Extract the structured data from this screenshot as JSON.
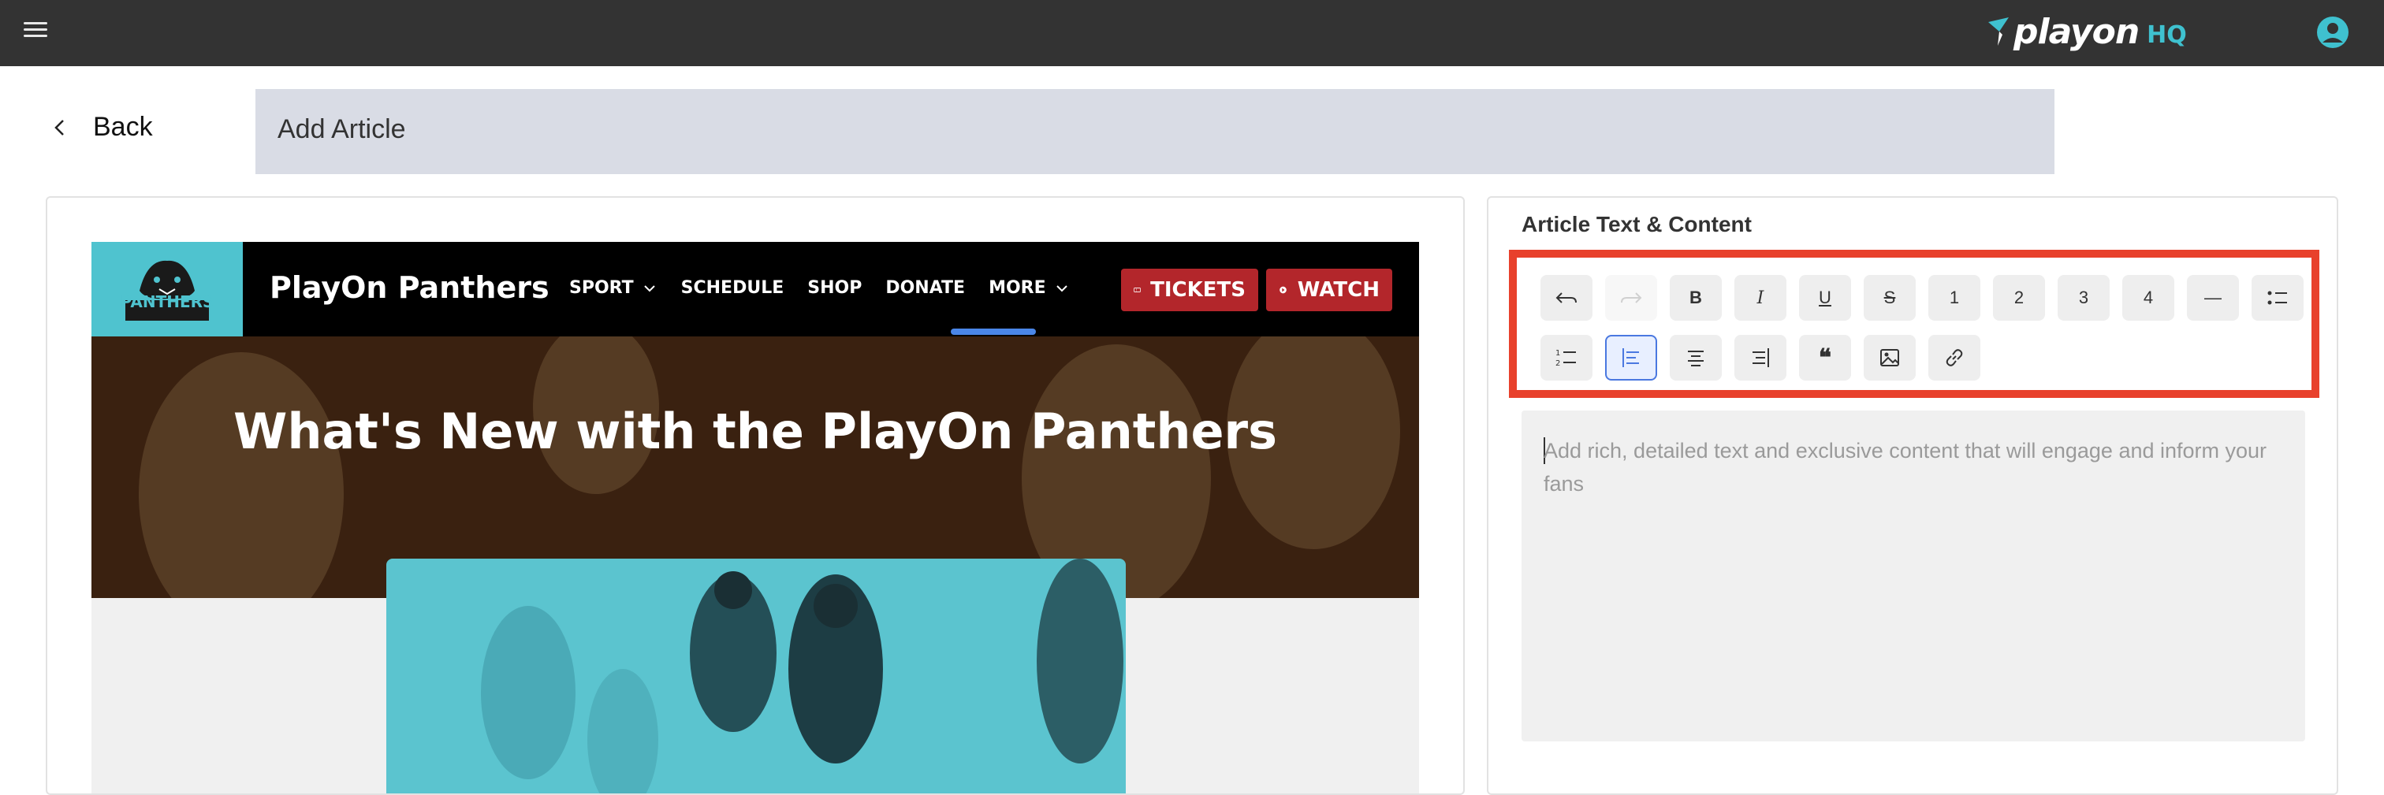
{
  "topbar": {
    "brand_word": "playon",
    "brand_suffix": "HQ",
    "brand_color": "#3fc1cf",
    "bg_color": "#333333"
  },
  "page": {
    "back_label": "Back",
    "title": "Add Article"
  },
  "preview": {
    "site_name": "PlayOn Panthers",
    "logo_text": "PANTHERS",
    "menu": [
      {
        "label": "SPORT",
        "has_dropdown": true
      },
      {
        "label": "SCHEDULE",
        "has_dropdown": false
      },
      {
        "label": "SHOP",
        "has_dropdown": false
      },
      {
        "label": "DONATE",
        "has_dropdown": false
      },
      {
        "label": "MORE",
        "has_dropdown": true
      }
    ],
    "tickets_label": "TICKETS",
    "watch_label": "WATCH",
    "hero_title": "What's New with the PlayOn Panthers",
    "accent_color": "#b3262b",
    "teal_color": "#4fc3cf"
  },
  "editor": {
    "section_label": "Article Text & Content",
    "placeholder": "Add rich, detailed text and exclusive content that will engage and inform your fans",
    "toolbar_row1": [
      {
        "icon": "undo-icon",
        "label": ""
      },
      {
        "icon": "redo-icon",
        "label": "",
        "disabled": true
      },
      {
        "icon": "bold-icon",
        "label": "B"
      },
      {
        "icon": "italic-icon",
        "label": "I"
      },
      {
        "icon": "underline-icon",
        "label": "U"
      },
      {
        "icon": "strikethrough-icon",
        "label": "S"
      },
      {
        "icon": "heading-1-icon",
        "label": "1"
      },
      {
        "icon": "heading-2-icon",
        "label": "2"
      },
      {
        "icon": "heading-3-icon",
        "label": "3"
      },
      {
        "icon": "heading-4-icon",
        "label": "4"
      },
      {
        "icon": "horizontal-rule-icon",
        "label": "—"
      },
      {
        "icon": "bullet-list-icon",
        "label": ""
      }
    ],
    "toolbar_row2": [
      {
        "icon": "ordered-list-icon",
        "label": ""
      },
      {
        "icon": "align-left-icon",
        "label": "",
        "active": true
      },
      {
        "icon": "align-center-icon",
        "label": ""
      },
      {
        "icon": "align-right-icon",
        "label": ""
      },
      {
        "icon": "blockquote-icon",
        "label": "❝"
      },
      {
        "icon": "image-icon",
        "label": ""
      },
      {
        "icon": "link-icon",
        "label": ""
      }
    ],
    "highlight_color": "#e8412c"
  }
}
